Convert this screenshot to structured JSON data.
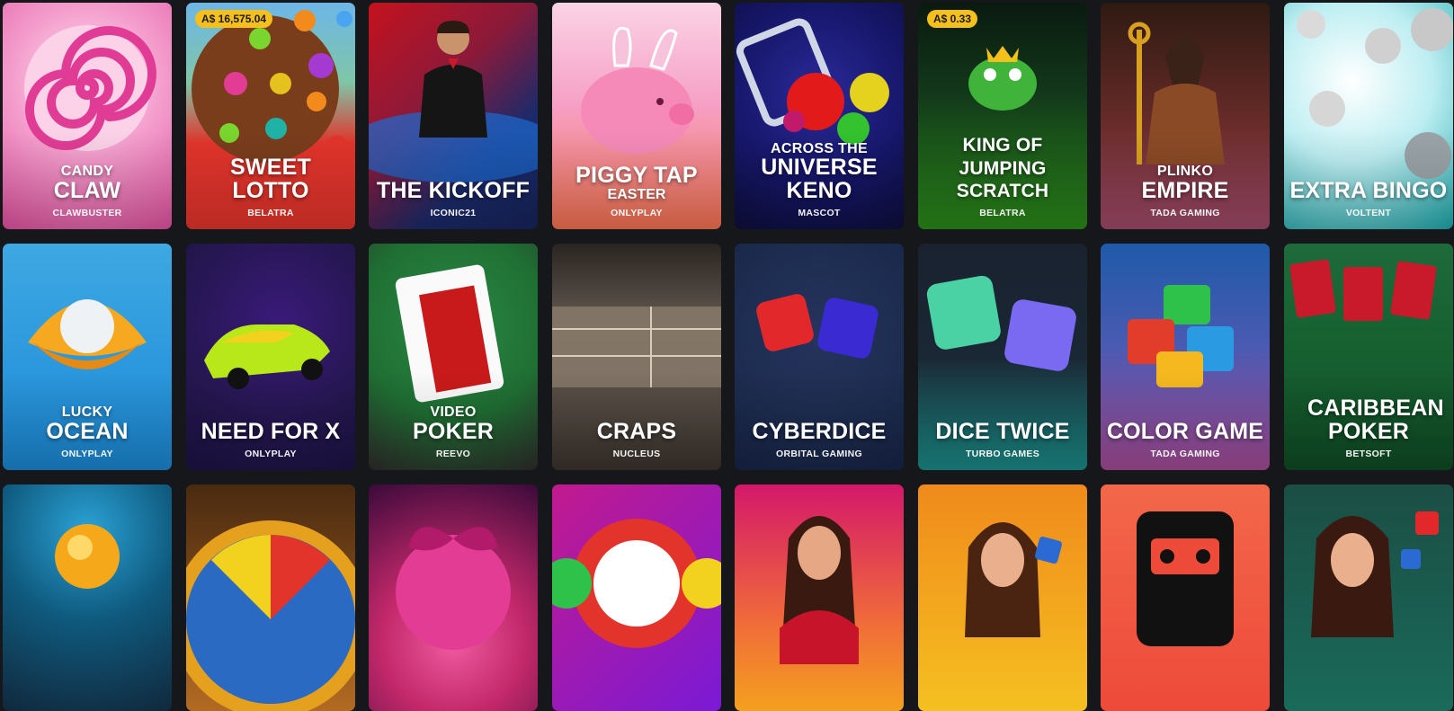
{
  "rows": [
    [
      {
        "pre": "CANDY",
        "main": "CLAW",
        "post": "",
        "provider": "CLAWBUSTER",
        "jackpot": "",
        "bg": [
          "#f7c6e0",
          "#e0509e"
        ]
      },
      {
        "pre": "",
        "main": "SWEET LOTTO",
        "post": "",
        "provider": "BELATRA",
        "jackpot": "A$ 16,575.04",
        "bg": [
          "#5aa0d8",
          "#e2342b"
        ]
      },
      {
        "pre": "",
        "main": "THE KICKOFF",
        "post": "",
        "provider": "ICONIC21",
        "jackpot": "",
        "bg": [
          "#c4121e",
          "#1b2a6a"
        ]
      },
      {
        "pre": "",
        "main": "PIGGY TAP",
        "post": "EASTER",
        "provider": "ONLYPLAY",
        "jackpot": "",
        "bg": [
          "#f5a0c8",
          "#f2704e"
        ]
      },
      {
        "pre": "ACROSS THE",
        "main": "UNIVERSE KENO",
        "post": "",
        "provider": "MASCOT",
        "jackpot": "",
        "bg": [
          "#1a1a6e",
          "#0d0d3a"
        ]
      },
      {
        "pre": "",
        "main": "KING OF JUMPING SCRATCH",
        "post": "",
        "provider": "BELATRA",
        "jackpot": "A$ 0.33",
        "bg": [
          "#0c2a14",
          "#2a8a1a"
        ]
      },
      {
        "pre": "PLINKO",
        "main": "EMPIRE",
        "post": "",
        "provider": "TADA GAMING",
        "jackpot": "",
        "bg": [
          "#3a1c12",
          "#a14a6a"
        ]
      },
      {
        "pre": "",
        "main": "EXTRA BINGO",
        "post": "",
        "provider": "VOLTENT",
        "jackpot": "",
        "bg": [
          "#d8f3f5",
          "#19a6a9"
        ]
      }
    ],
    [
      {
        "pre": "LUCKY",
        "main": "OCEAN",
        "post": "",
        "provider": "ONLYPLAY",
        "jackpot": "",
        "bg": [
          "#4db8e8",
          "#1a86d0"
        ]
      },
      {
        "pre": "",
        "main": "NEED FOR X",
        "post": "",
        "provider": "ONLYPLAY",
        "jackpot": "",
        "bg": [
          "#1b1244",
          "#24164e"
        ]
      },
      {
        "pre": "VIDEO",
        "main": "POKER",
        "post": "",
        "provider": "REEVO",
        "jackpot": "",
        "bg": [
          "#1f6e33",
          "#2e2a2a"
        ]
      },
      {
        "pre": "",
        "main": "CRAPS",
        "post": "",
        "provider": "NUCLEUS",
        "jackpot": "",
        "bg": [
          "#3b332c",
          "#4a3a30"
        ]
      },
      {
        "pre": "",
        "main": "CYBERDICE",
        "post": "",
        "provider": "ORBITAL GAMING",
        "jackpot": "",
        "bg": [
          "#162346",
          "#1c2b4e"
        ]
      },
      {
        "pre": "",
        "main": "DICE TWICE",
        "post": "",
        "provider": "TURBO GAMES",
        "jackpot": "",
        "bg": [
          "#1a2734",
          "#1a8c88"
        ]
      },
      {
        "pre": "",
        "main": "COLOR GAME",
        "post": "",
        "provider": "TADA GAMING",
        "jackpot": "",
        "bg": [
          "#1f5aa8",
          "#a44a94"
        ]
      },
      {
        "pre": "",
        "main": "CARIBBEAN POKER",
        "post": "",
        "provider": "BETSOFT",
        "jackpot": "",
        "bg": [
          "#1e6a3a",
          "#0f4a24"
        ]
      }
    ],
    [
      {
        "pre": "",
        "main": "",
        "post": "",
        "provider": "",
        "jackpot": "",
        "bg": [
          "#0f5a7e",
          "#10283c"
        ]
      },
      {
        "pre": "",
        "main": "",
        "post": "",
        "provider": "",
        "jackpot": "",
        "bg": [
          "#7a4a18",
          "#b26a22"
        ]
      },
      {
        "pre": "",
        "main": "",
        "post": "",
        "provider": "",
        "jackpot": "",
        "bg": [
          "#3a0a3a",
          "#c2286a"
        ]
      },
      {
        "pre": "",
        "main": "",
        "post": "",
        "provider": "",
        "jackpot": "",
        "bg": [
          "#c21a8e",
          "#7a1ad6"
        ]
      },
      {
        "pre": "",
        "main": "",
        "post": "",
        "provider": "",
        "jackpot": "",
        "bg": [
          "#d4186a",
          "#f4a01e"
        ]
      },
      {
        "pre": "",
        "main": "",
        "post": "",
        "provider": "",
        "jackpot": "",
        "bg": [
          "#f08a1c",
          "#f5c020"
        ]
      },
      {
        "pre": "",
        "main": "",
        "post": "",
        "provider": "",
        "jackpot": "",
        "bg": [
          "#f2674a",
          "#ee4a3a"
        ]
      },
      {
        "pre": "",
        "main": "",
        "post": "",
        "provider": "",
        "jackpot": "",
        "bg": [
          "#1b4e44",
          "#1a6a5a"
        ]
      }
    ]
  ]
}
